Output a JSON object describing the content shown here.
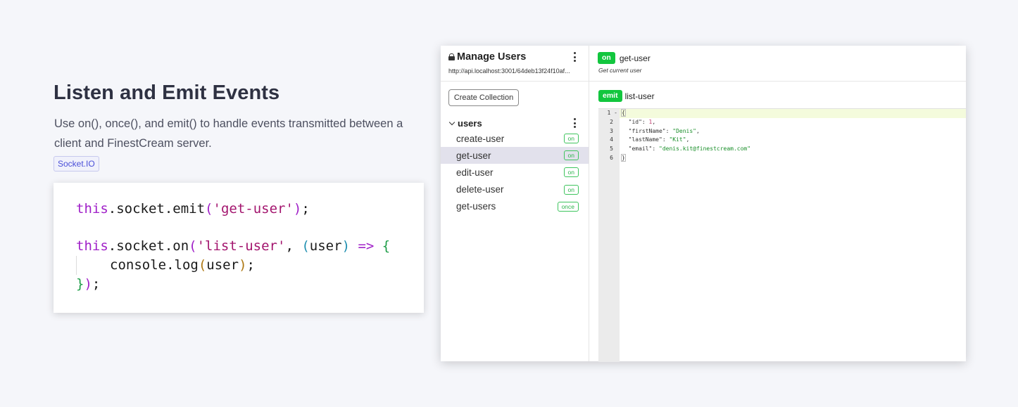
{
  "intro": {
    "title": "Listen and Emit Events",
    "description_line1": "Use on(), once(), and emit() to handle events transmitted between a",
    "description_line2": "client and FinestCream server.",
    "tag": "Socket.IO"
  },
  "code_sample": {
    "line1": {
      "kw": "this",
      "rest1": ".socket.emit",
      "open": "(",
      "str": "'get-user'",
      "close": ")",
      "end": ";"
    },
    "line2": {
      "kw": "this",
      "rest1": ".socket.on",
      "open": "(",
      "str": "'list-user'",
      "comma": ", ",
      "p_open": "(",
      "param": "user",
      "p_close": ")",
      "arrow": " => ",
      "brace": "{"
    },
    "line3": {
      "text": "console.log",
      "open": "(",
      "arg": "user",
      "close": ")",
      "end": ";"
    },
    "line4": {
      "brace": "}",
      "close": ")",
      "end": ";"
    }
  },
  "sidebar": {
    "title": "Manage Users",
    "url": "http://api.localhost:3001/64deb13f24f10af...",
    "create_button": "Create Collection",
    "group": "users",
    "events": [
      {
        "name": "create-user",
        "type": "on"
      },
      {
        "name": "get-user",
        "type": "on",
        "active": true
      },
      {
        "name": "edit-user",
        "type": "on"
      },
      {
        "name": "delete-user",
        "type": "on"
      },
      {
        "name": "get-users",
        "type": "once"
      }
    ]
  },
  "event_panel": {
    "type": "on",
    "name": "get-user",
    "description": "Get current user",
    "emit_type": "emit",
    "emit_name": "list-user"
  },
  "editor": {
    "line_numbers": [
      "1",
      "2",
      "3",
      "4",
      "5",
      "6"
    ],
    "first_line_marker": "1 -",
    "lines": {
      "l1": "{",
      "l2_key": "\"id\"",
      "l2_val": "1",
      "l3_key": "\"firstName\"",
      "l3_val": "\"Denis\"",
      "l4_key": "\"lastName\"",
      "l4_val": "\"Kit\"",
      "l5_key": "\"email\"",
      "l5_val": "\"denis.kit@finestcream.com\"",
      "l6": "}"
    }
  },
  "colors": {
    "accent_green": "#12c63e",
    "active_row": "#e2e1ec",
    "keyword_purple": "#a020c8"
  }
}
